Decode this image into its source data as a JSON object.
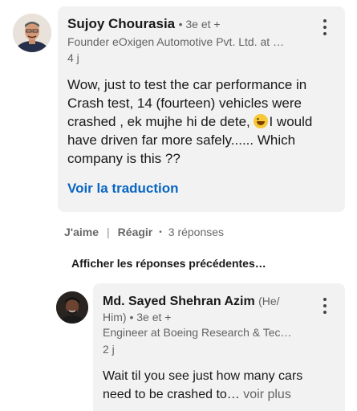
{
  "comment": {
    "author": "Sujoy Chourasia",
    "degree": "• 3e et +",
    "headline": "Founder eOxigen Automotive Pvt. Ltd. at …",
    "time": "4 j",
    "text_lines": [
      "Wow, just to test the car performance in",
      "Crash test, 14 (fourteen) vehicles were",
      "crashed , ek mujhe hi de dete, ",
      "I would",
      "have driven far more safely...... Which",
      "company is this ??"
    ],
    "emoji": "grinning-sweat-emoji",
    "translate_label": "Voir la traduction",
    "menu_icon": "more-vertical-icon"
  },
  "actions": {
    "like": "J'aime",
    "separator": "|",
    "react": "Réagir",
    "dot": "•",
    "replies": "3 réponses"
  },
  "show_previous": "Afficher les réponses précédentes…",
  "reply": {
    "author_line1": "Md. Sayed Shehran Azim",
    "pronoun_line1": "(He/",
    "pronoun_line2": "Him)",
    "degree": "• 3e et +",
    "headline": "Engineer at Boeing Research & Tec…",
    "time": "2 j",
    "text_line1": "Wait til you see just how many cars",
    "text_line2": "need to be crashed to…",
    "see_more": "voir plus",
    "menu_icon": "more-vertical-icon"
  },
  "colors": {
    "bubble": "#f2f2f2",
    "link_blue": "#0a66c2"
  }
}
